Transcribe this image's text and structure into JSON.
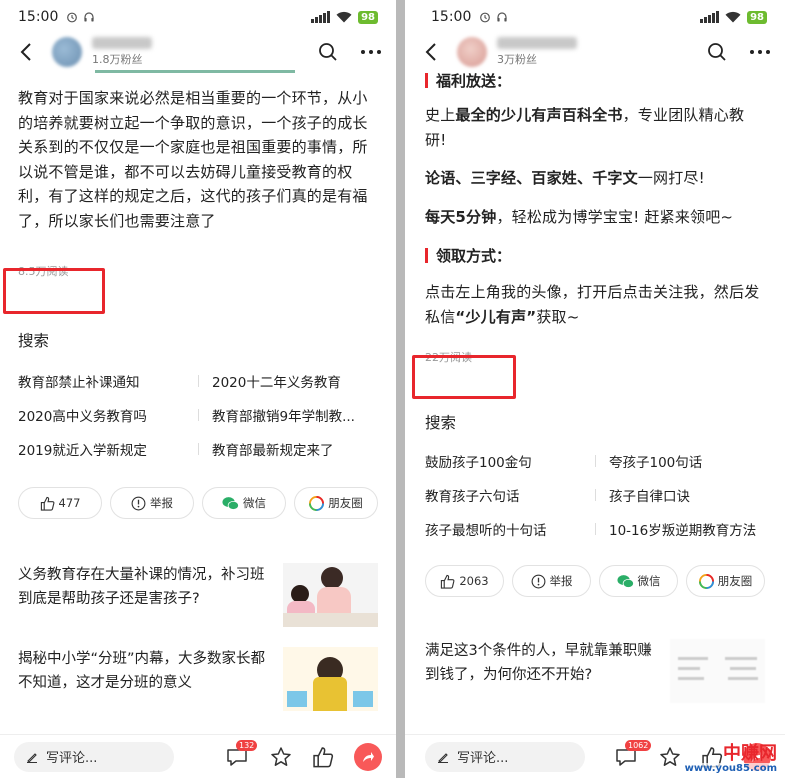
{
  "left": {
    "status": {
      "time": "15:00",
      "battery": "98"
    },
    "author": {
      "fans": "1.8万粉丝"
    },
    "article_text": "教育对于国家来说必然是相当重要的一个环节，从小的培养就要树立起一个争取的意识，一个孩子的成长关系到的不仅仅是一个家庭也是祖国重要的事情，所以说不管是谁，都不可以去妨碍儿童接受教育的权利，有了这样的规定之后，这代的孩子们真的是有福了，所以家长们也需要注意了",
    "reads": "8.5万阅读",
    "search": {
      "title": "搜索",
      "items": [
        "教育部禁止补课通知",
        "2020十二年义务教育",
        "2020高中义务教育吗",
        "教育部撤销9年学制教...",
        "2019就近入学新规定",
        "教育部最新规定来了"
      ]
    },
    "actions": {
      "like": "477",
      "report": "举报",
      "wechat": "微信",
      "moments": "朋友圈"
    },
    "feed": [
      {
        "title": "义务教育存在大量补课的情况，补习班到底是帮助孩子还是害孩子?"
      },
      {
        "title": "揭秘中小学“分班”内幕，大多数家长都不知道，这才是分班的意义"
      }
    ],
    "bottom": {
      "comment_placeholder": "写评论...",
      "comment_count": "132"
    }
  },
  "right": {
    "status": {
      "time": "15:00",
      "battery": "98"
    },
    "author": {
      "fans": "3万粉丝"
    },
    "section1": "福利放送：",
    "p1_pre": "史上",
    "p1_bold": "最全的少儿有声百科全书",
    "p1_post": "，专业团队精心教研!",
    "p2_bold": "论语、三字经、百家姓、千字文",
    "p2_post": "一网打尽!",
    "p3_bold": "每天5分钟",
    "p3_post": "，轻松成为博学宝宝! 赶紧来领吧~",
    "section2": "领取方式：",
    "p4_pre": "点击左上角我的头像，打开后点击关注我，然后发私信",
    "p4_bold": "“少儿有声”",
    "p4_post": "获取~",
    "reads": "22万阅读",
    "search": {
      "title": "搜索",
      "items": [
        "鼓励孩子100金句",
        "夸孩子100句话",
        "教育孩子六句话",
        "孩子自律口诀",
        "孩子最想听的十句话",
        "10-16岁叛逆期教育方法"
      ]
    },
    "actions": {
      "like": "2063",
      "report": "举报",
      "wechat": "微信",
      "moments": "朋友圈"
    },
    "feed": [
      {
        "title": "满足这3个条件的人，早就靠兼职赚到钱了，为何你还不开始?"
      }
    ],
    "bottom": {
      "comment_placeholder": "写评论...",
      "comment_count": "1062"
    }
  },
  "watermark": {
    "text": "中赚网",
    "url": "www.you85.com"
  },
  "colors": {
    "highlight": "#e8262c",
    "share": "#f85959",
    "badge": "#f04142",
    "battery": "#6dbb2f"
  }
}
